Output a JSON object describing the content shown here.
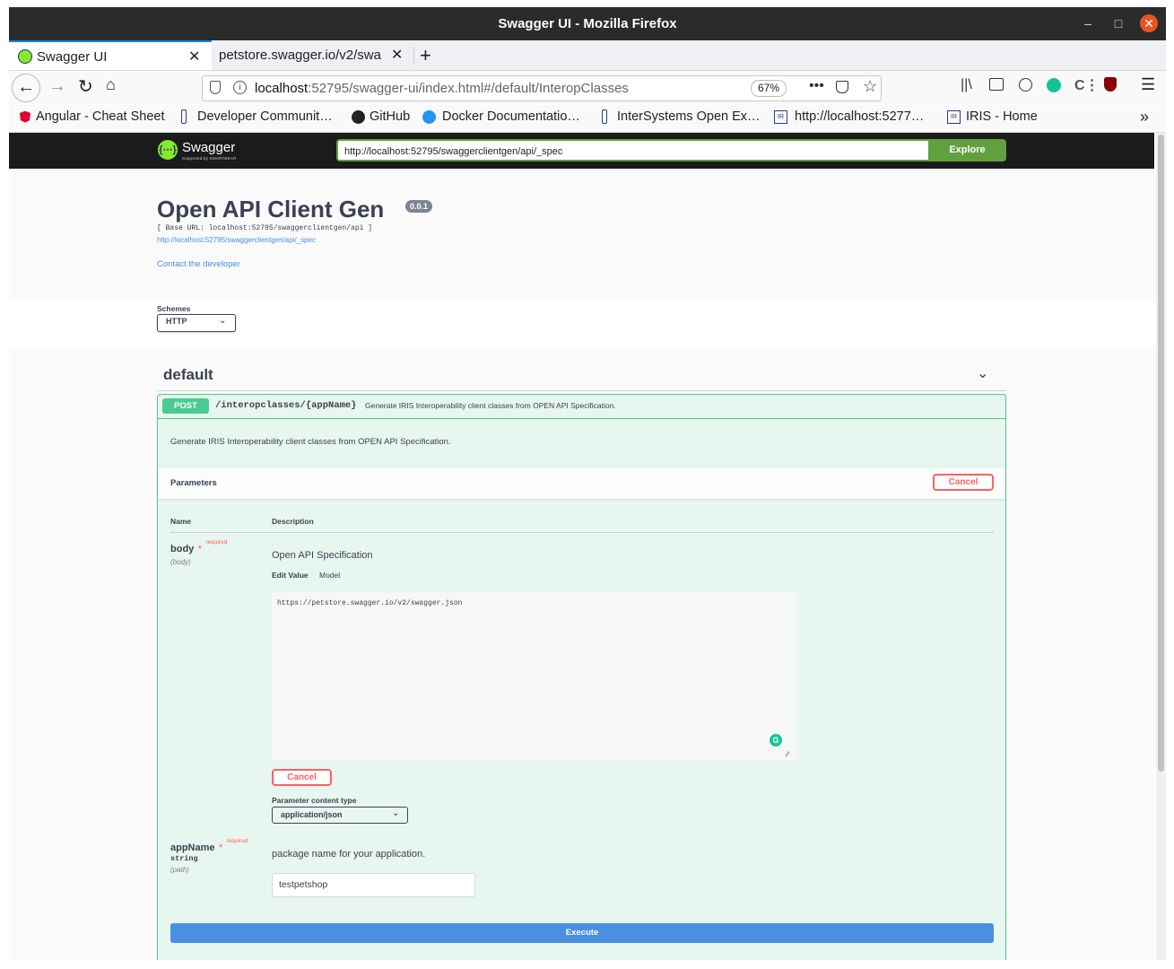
{
  "window": {
    "title": "Swagger UI - Mozilla Firefox"
  },
  "tabs": [
    {
      "label": "Swagger UI",
      "active": true
    },
    {
      "label": "petstore.swagger.io/v2/swa",
      "active": false
    }
  ],
  "url": {
    "host": "localhost",
    "rest": ":52795/swagger-ui/index.html#/default/InteropClasses",
    "zoom": "67%"
  },
  "bookmarks": [
    "Angular - Cheat Sheet",
    "Developer Communit…",
    "GitHub",
    "Docker Documentatio…",
    "InterSystems Open Ex…",
    "http://localhost:5277…",
    "IRIS - Home"
  ],
  "swagger": {
    "brand": "Swagger",
    "brand_sub": "Supported by SMARTBEAR",
    "spec_url": "http://localhost:52795/swaggerclientgen/api/_spec",
    "explore_label": "Explore",
    "title": "Open API Client Gen",
    "version": "0.0.1",
    "base_url": "[ Base URL: localhost:52795/swaggerclientgen/api ]",
    "spec_link": "http://localhost:52795/swaggerclientgen/api/_spec",
    "contact": "Contact the developer",
    "schemes_label": "Schemes",
    "scheme_value": "HTTP",
    "tag": "default",
    "operation": {
      "method": "POST",
      "path": "/interopclasses/{appName}",
      "summary": "Generate IRIS Interoperability client classes from OPEN API Specification.",
      "description": "Generate IRIS Interoperability client classes from OPEN API Specification.",
      "parameters_label": "Parameters",
      "cancel_label": "Cancel",
      "col_name": "Name",
      "col_description": "Description",
      "required_star": "*",
      "required_label": "required",
      "params": {
        "body": {
          "name": "body",
          "location": "(body)",
          "description": "Open API Specification",
          "tab_edit": "Edit Value",
          "tab_model": "Model",
          "value": "https://petstore.swagger.io/v2/swagger.json",
          "cancel_label": "Cancel",
          "content_type_label": "Parameter content type",
          "content_type_value": "application/json"
        },
        "appName": {
          "name": "appName",
          "type": "string",
          "location": "(path)",
          "description": "package name for your application.",
          "value": "testpetshop"
        }
      },
      "execute_label": "Execute"
    }
  }
}
